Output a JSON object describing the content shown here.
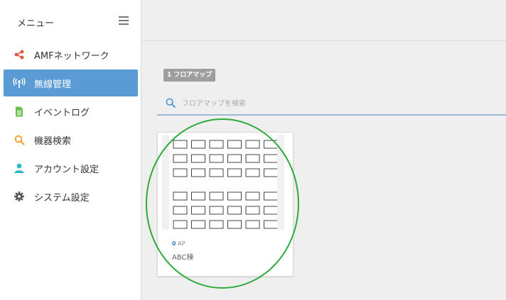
{
  "sidebar": {
    "title": "メニュー",
    "items": [
      {
        "label": "AMFネットワーク",
        "icon": "share-icon",
        "active": false
      },
      {
        "label": "無線管理",
        "icon": "wireless-antenna-icon",
        "active": true
      },
      {
        "label": "イベントログ",
        "icon": "document-icon",
        "active": false
      },
      {
        "label": "機器検索",
        "icon": "search-icon",
        "active": false
      },
      {
        "label": "アカウント設定",
        "icon": "user-icon",
        "active": false
      },
      {
        "label": "システム設定",
        "icon": "gear-icon",
        "active": false
      }
    ]
  },
  "main": {
    "count_badge": "1 フロアマップ",
    "search": {
      "placeholder": "フロアマップを検索",
      "value": ""
    },
    "cards": [
      {
        "ap_count": "0",
        "ap_unit": "AP",
        "name": "ABC棟"
      }
    ]
  },
  "colors": {
    "accent": "#5b9bd5",
    "share_icon": "#e0533f",
    "document_icon": "#6cc04a",
    "search_icon": "#f0a030",
    "user_icon": "#29b6c8",
    "gear_icon": "#555555",
    "annotation_circle": "#2eaa3c"
  }
}
